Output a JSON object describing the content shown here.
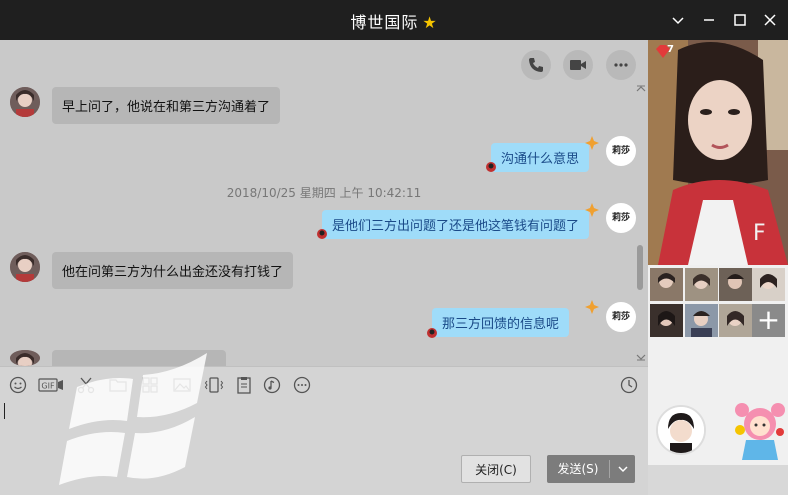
{
  "window": {
    "title": "博世国际",
    "title_star_icon": "star-icon",
    "controls": [
      "chevron-down-icon",
      "minimize-icon",
      "maximize-icon",
      "close-icon"
    ]
  },
  "chat_toolbar": {
    "icons": [
      "phone-icon",
      "video-camera-icon",
      "more-icon"
    ]
  },
  "messages": [
    {
      "side": "left",
      "text": "早上问了，他说在和第三方沟通着了"
    },
    {
      "side": "right",
      "text": "沟通什么意思",
      "sender_badge": "莉莎"
    },
    {
      "type": "timestamp",
      "text": "2018/10/25 星期四 上午 10:42:11"
    },
    {
      "side": "right",
      "text": "是他们三方出问题了还是他这笔钱有问题了",
      "sender_badge": "莉莎"
    },
    {
      "side": "left",
      "text": "他在问第三方为什么出金还没有打钱了"
    },
    {
      "side": "right",
      "text": "那三方回馈的信息呢",
      "sender_badge": "莉莎"
    },
    {
      "side": "left",
      "text": ""
    }
  ],
  "input_toolbar": {
    "tools": [
      "emoji-icon",
      "gif-icon",
      "scissors-icon",
      "folder-icon",
      "gallery-icon",
      "image-icon",
      "vibrate-icon",
      "clipboard-icon",
      "music-icon",
      "more-icon"
    ],
    "gif_label": "GIF",
    "history_icon": "clock-icon"
  },
  "input": {
    "value": ""
  },
  "buttons": {
    "close_label": "关闭(C)",
    "send_label": "发送(S)",
    "send_dropdown_icon": "chevron-down-icon"
  },
  "right_panel": {
    "badge_count": "7",
    "add_photo_label": "+"
  },
  "colors": {
    "titlebar": "#1f1f1f",
    "bubble_left": "#b6b6b6",
    "bubble_right": "#9fdcf9",
    "bubble_right_text": "#1a4a88",
    "send_button": "#7c7c7c"
  }
}
